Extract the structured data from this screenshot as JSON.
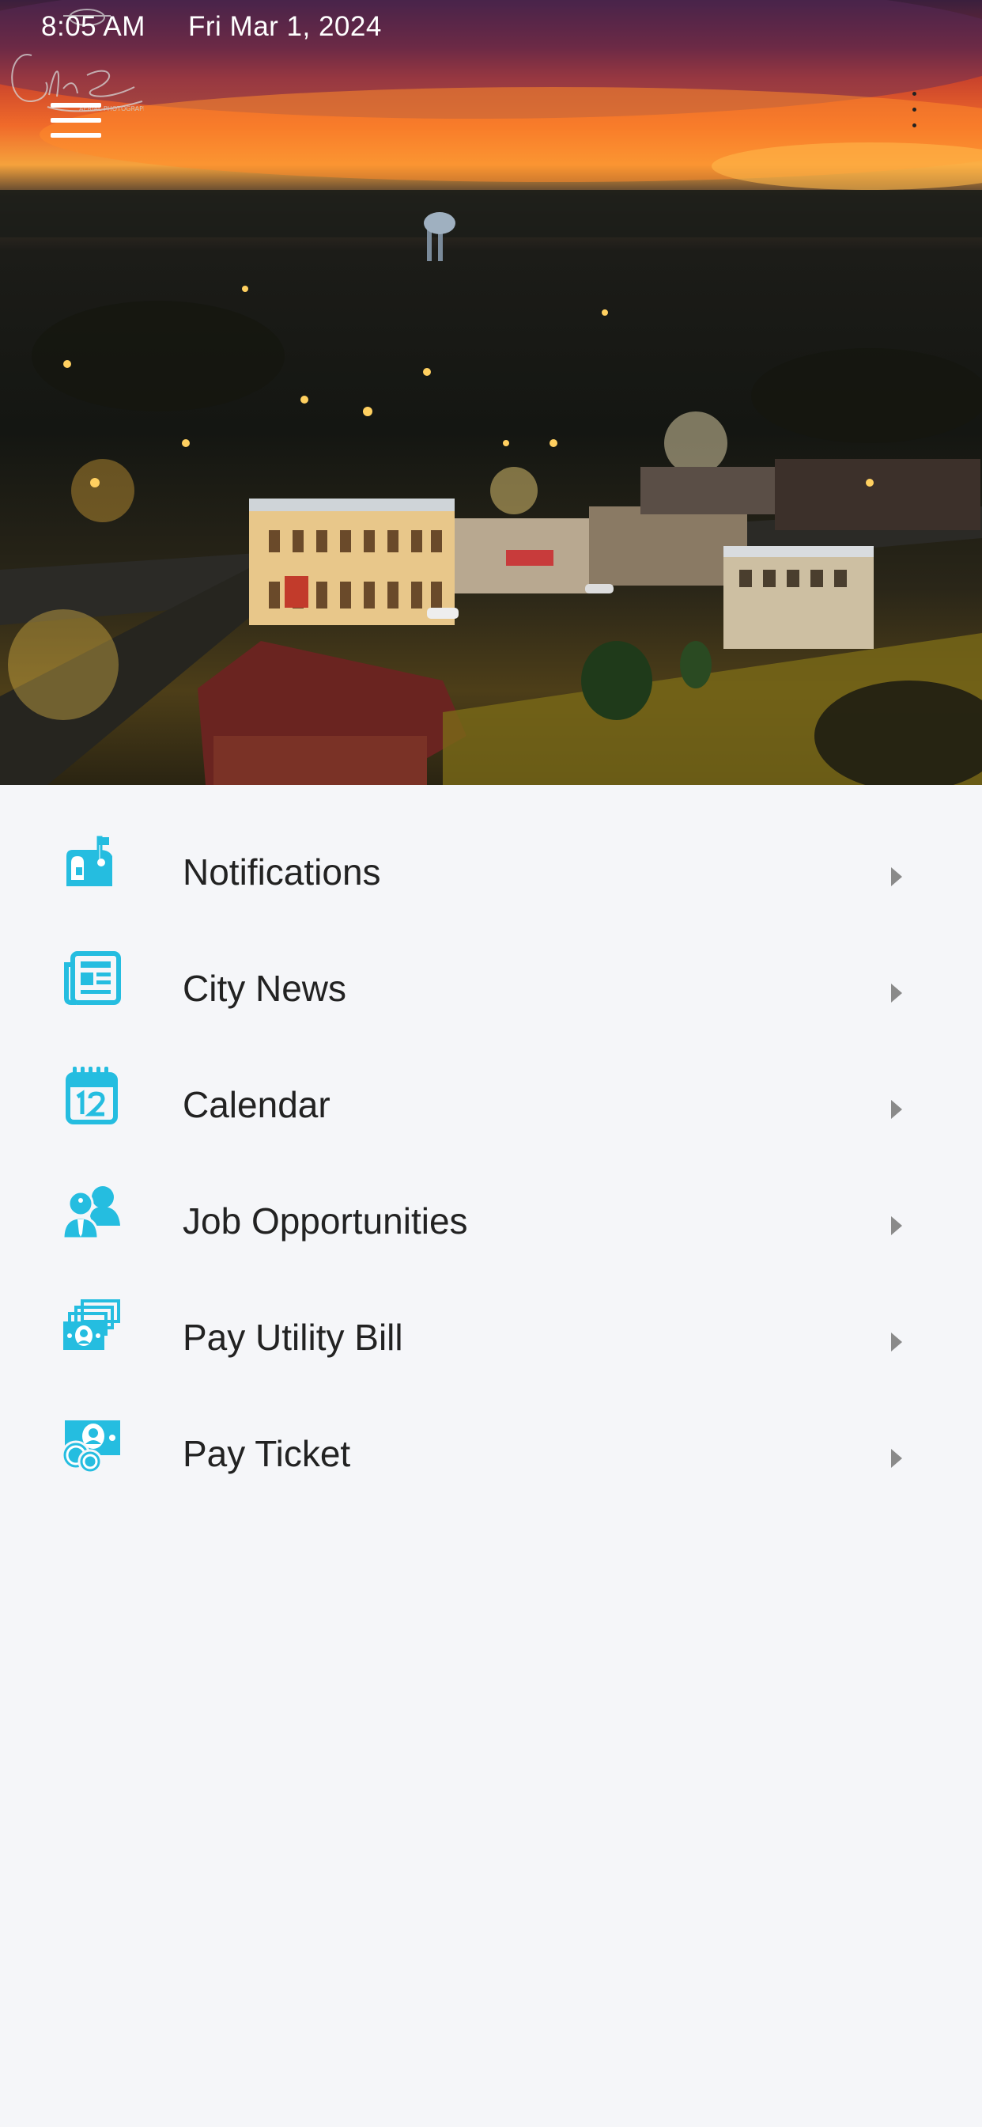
{
  "status_bar": {
    "time": "8:05 AM",
    "date": "Fri Mar 1, 2024"
  },
  "hero": {
    "image_subject": "aerial-night-town-sunset",
    "watermark_text": "Chris Sims"
  },
  "header": {
    "menu_icon": "hamburger-menu-icon",
    "more_icon": "more-vertical-icon"
  },
  "colors": {
    "accent": "#25bde0",
    "background": "#f5f6f9",
    "text": "#222222",
    "chevron": "#8a8a8a"
  },
  "menu": {
    "items": [
      {
        "label": "Notifications",
        "icon": "mailbox-icon"
      },
      {
        "label": "City News",
        "icon": "newspaper-icon"
      },
      {
        "label": "Calendar",
        "icon": "calendar-icon"
      },
      {
        "label": "Job Opportunities",
        "icon": "users-icon"
      },
      {
        "label": "Pay Utility Bill",
        "icon": "money-stack-icon"
      },
      {
        "label": "Pay Ticket",
        "icon": "money-coins-icon"
      }
    ]
  }
}
